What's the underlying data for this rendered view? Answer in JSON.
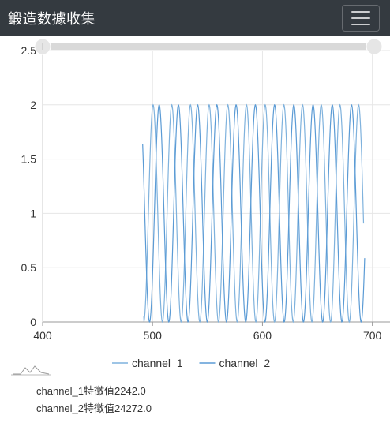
{
  "app": {
    "title": "鍛造数據收集"
  },
  "chart_data": {
    "type": "line",
    "xlim": [
      400,
      700
    ],
    "ylim": [
      0,
      2.5
    ],
    "xticks": [
      "400",
      "500",
      "600",
      "700"
    ],
    "yticks": [
      "0",
      "0.5",
      "1",
      "1.5",
      "2",
      "2.5"
    ],
    "grid": true,
    "legend_position": "bottom",
    "series": [
      {
        "name": "channel_1",
        "color": "#7fb2dd",
        "start_x": 492,
        "end_x": 692,
        "amplitude": 1.0,
        "offset": 1.0,
        "period": 17,
        "start_value": 0.05
      },
      {
        "name": "channel_2",
        "color": "#5b9bd5",
        "start_x": 491,
        "end_x": 693,
        "amplitude": 1.0,
        "offset": 1.0,
        "period": 17.5,
        "start_value": 1.64
      }
    ]
  },
  "features": [
    {
      "label": "channel_1特徴值2242.0"
    },
    {
      "label": "channel_2特徴值24272.0"
    }
  ]
}
